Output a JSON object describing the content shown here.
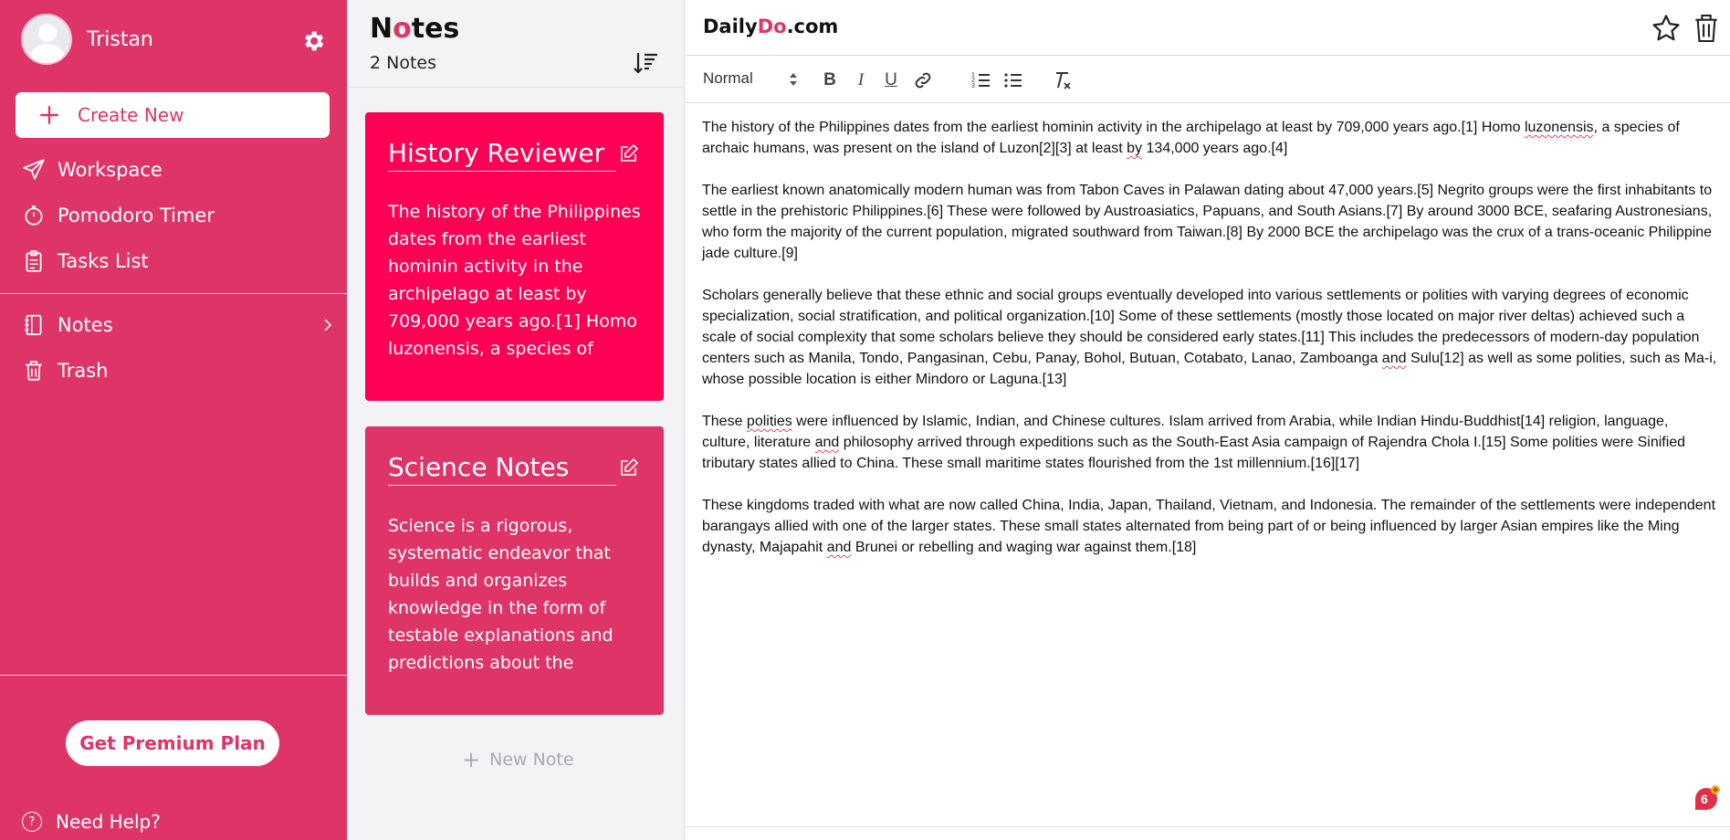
{
  "sidebar": {
    "username": "Tristan",
    "create_label": "Create New",
    "items": [
      {
        "label": "Workspace"
      },
      {
        "label": "Pomodoro Timer"
      },
      {
        "label": "Tasks List"
      },
      {
        "label": "Notes"
      },
      {
        "label": "Trash"
      }
    ],
    "premium_label": "Get Premium Plan",
    "help_label": "Need Help?",
    "help_glyph": "?"
  },
  "notes": {
    "title_n": "N",
    "title_o": "o",
    "title_rest": "tes",
    "count": "2 Notes",
    "cards": [
      {
        "title": "History Reviewer",
        "preview": "The history of the Philippines dates from the earliest hominin activity in the archipelago at least by 709,000 years ago.[1] Homo luzonensis, a species of archaic humans, was present..."
      },
      {
        "title": "Science Notes",
        "preview": "Science is a rigorous, systematic endeavor that builds and organizes knowledge in the form of testable explanations and predictions about the world...."
      }
    ],
    "new_note_plus": "+",
    "new_note_label": "New Note"
  },
  "editor": {
    "brand_daily": "Daily",
    "brand_do": "Do",
    "brand_com": ".com",
    "format_value": "Normal",
    "toolbar": {
      "bold": "B",
      "italic": "I",
      "underline": "U"
    },
    "p1": {
      "a": "The history of the Philippines dates from the earliest hominin activity in the archipelago at least by 709,000 years ago.[1] Homo ",
      "b": "luzonensis",
      "c": ", a species of archaic humans, was present on the island of Luzon[2][3] at least ",
      "d": "by",
      "e": " 134,000 years ago.[4]"
    },
    "p2": "The earliest known anatomically modern human was from Tabon Caves in Palawan dating about 47,000 years.[5] Negrito groups were the first inhabitants to settle in the prehistoric Philippines.[6] These were followed by Austroasiatics, Papuans, and South Asians.[7] By around 3000 BCE, seafaring Austronesians, who form the majority of the current population, migrated southward from Taiwan.[8] By 2000 BCE the archipelago was the crux of a trans-oceanic Philippine jade culture.[9]",
    "p3": {
      "a": "Scholars generally believe that these ethnic and social groups eventually developed into various settlements or polities with varying degrees of economic specialization, social stratification, and political organization.[10] Some of these settlements (mostly those located on major river deltas) achieved such a scale of social complexity that some scholars believe they should be considered early states.[11] This includes the predecessors of modern-day population centers such as Manila, Tondo, Pangasinan, Cebu, Panay, Bohol, Butuan, Cotabato, Lanao, Zamboanga ",
      "b": "and",
      "c": " Sulu[12] as well as some polities, such as Ma-i, whose possible location is either Mindoro or Laguna.[13]"
    },
    "p4": {
      "a": "These ",
      "b": "polities",
      "c": " were influenced by Islamic, Indian, and Chinese cultures. Islam arrived from Arabia, while Indian Hindu-Buddhist[14] religion, language, culture, literature ",
      "d": "and",
      "e": " philosophy arrived through expeditions such as the South-East Asia campaign of Rajendra Chola I.[15] Some polities were Sinified tributary states allied to China. These small maritime states flourished from the 1st millennium.[16][17]"
    },
    "p5": {
      "a": "These kingdoms traded with what are now called China, India, Japan, Thailand, Vietnam, and Indonesia. The remainder of the settlements were independent barangays allied with one of the larger states. These small states alternated from being part of or being influenced by larger Asian empires like the Ming dynasty, Majapahit ",
      "b": "and",
      "c": " Brunei or rebelling and waging war against them.[18]"
    },
    "badge_count": "6"
  },
  "colors": {
    "brand": "#de3468",
    "active_card": "#ff0054"
  }
}
